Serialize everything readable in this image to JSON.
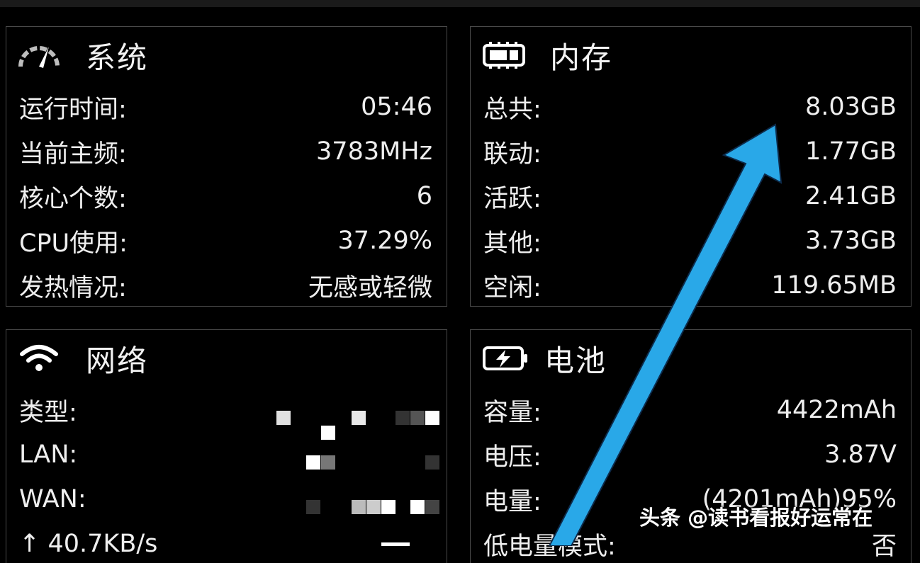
{
  "system": {
    "title": "系统",
    "icon": "speedometer-icon",
    "rows": [
      {
        "label": "运行时间:",
        "value": "05:46"
      },
      {
        "label": "当前主频:",
        "value": "3783MHz"
      },
      {
        "label": "核心个数:",
        "value": "6"
      },
      {
        "label": "CPU使用:",
        "value": "37.29%"
      },
      {
        "label": "发热情况:",
        "value": "无感或轻微"
      }
    ]
  },
  "memory": {
    "title": "内存",
    "icon": "memory-chip-icon",
    "rows": [
      {
        "label": "总共:",
        "value": "8.03GB"
      },
      {
        "label": "联动:",
        "value": "1.77GB"
      },
      {
        "label": "活跃:",
        "value": "2.41GB"
      },
      {
        "label": "其他:",
        "value": "3.73GB"
      },
      {
        "label": "空闲:",
        "value": "119.65MB"
      }
    ]
  },
  "network": {
    "title": "网络",
    "icon": "wifi-icon",
    "rows": [
      {
        "label": "类型:",
        "value": ""
      },
      {
        "label": "LAN:",
        "value": ""
      },
      {
        "label": "WAN:",
        "value": ""
      },
      {
        "label": "↑ 40.7KB/s",
        "value": ""
      }
    ]
  },
  "battery": {
    "title": "电池",
    "icon": "battery-charging-icon",
    "rows": [
      {
        "label": "容量:",
        "value": "4422mAh"
      },
      {
        "label": "电压:",
        "value": "3.87V"
      },
      {
        "label": "电量:",
        "value": "(4201mAh)95%"
      },
      {
        "label": "低电量模式:",
        "value": "否"
      }
    ]
  },
  "watermark": "头条 @读书看报好运常在",
  "colors": {
    "background": "#000000",
    "border": "#4a4a4a",
    "text": "#f2f2f2",
    "arrow": "#29a8e8"
  }
}
